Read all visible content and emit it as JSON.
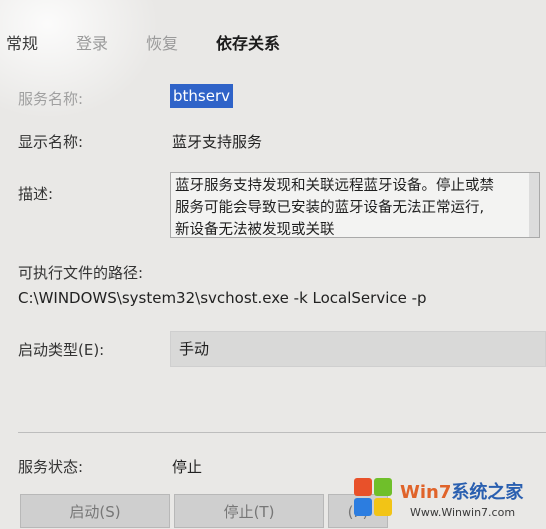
{
  "tabs": [
    "常规",
    "登录",
    "恢复",
    "依存关系"
  ],
  "fields": {
    "service_name_label": "服务名称:",
    "service_name_value": "bthserv",
    "display_name_label": "显示名称:",
    "display_name_value": "蓝牙支持服务",
    "description_label": "描述:",
    "description_lines": [
      "蓝牙服务支持发现和关联远程蓝牙设备。停止或禁",
      "服务可能会导致已安装的蓝牙设备无法正常运行,",
      "新设备无法被发现或关联"
    ],
    "exe_path_label": "可执行文件的路径:",
    "exe_path_value": "C:\\WINDOWS\\system32\\svchost.exe -k LocalService -p",
    "startup_type_label": "启动类型(E):",
    "startup_type_value": "手动",
    "service_status_label": "服务状态:",
    "service_status_value": "停止"
  },
  "buttons": {
    "start": "启动(S)",
    "stop": "停止(T)",
    "pause": "(P)"
  },
  "watermark": {
    "text_prefix": "Win7",
    "text_suffix": "系统之家",
    "url": "Www.Winwin7.com"
  },
  "colors": {
    "selection": "#2f63c8",
    "window_bg": "#e9e8e6"
  }
}
